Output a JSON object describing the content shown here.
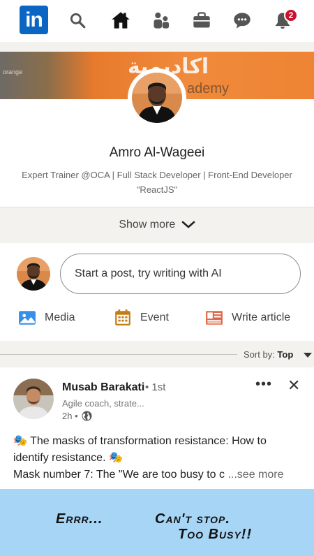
{
  "nav": {
    "logo": "in",
    "notification_count": "2",
    "icons": [
      "search-icon",
      "home-icon",
      "my-network-icon",
      "jobs-icon",
      "messaging-icon",
      "notifications-icon"
    ]
  },
  "profile": {
    "banner_arabic": "اكاديمية",
    "banner_english": "ademy",
    "banner_small": "orange",
    "name": "Amro Al-Wageei",
    "headline": "Expert Trainer @OCA | Full Stack Developer | Front-End Developer \"ReactJS\"",
    "show_more": "Show more"
  },
  "share": {
    "placeholder": "Start a post, try writing with AI",
    "actions": {
      "media": "Media",
      "event": "Event",
      "article": "Write article"
    }
  },
  "sort": {
    "label": "Sort by:",
    "value": "Top"
  },
  "post": {
    "author": "Musab Barakati",
    "degree": "• 1st",
    "title": "Agile coach, strate...",
    "time": "2h •",
    "more": "•••",
    "close": "✕",
    "text_line1": "The masks of transformation resistance: How to",
    "text_line2": "identify resistance.",
    "text_line3": "Mask number 7: The \"We are too busy to c",
    "see_more": "...see more",
    "image_text1": "Errr...",
    "image_text2": "Can't stop.",
    "image_text3": "Too Busy!!"
  },
  "colors": {
    "brand": "#0a66c2",
    "badge": "#cb112d",
    "media": "#378fe9",
    "event": "#c37d16",
    "article": "#e06847"
  }
}
